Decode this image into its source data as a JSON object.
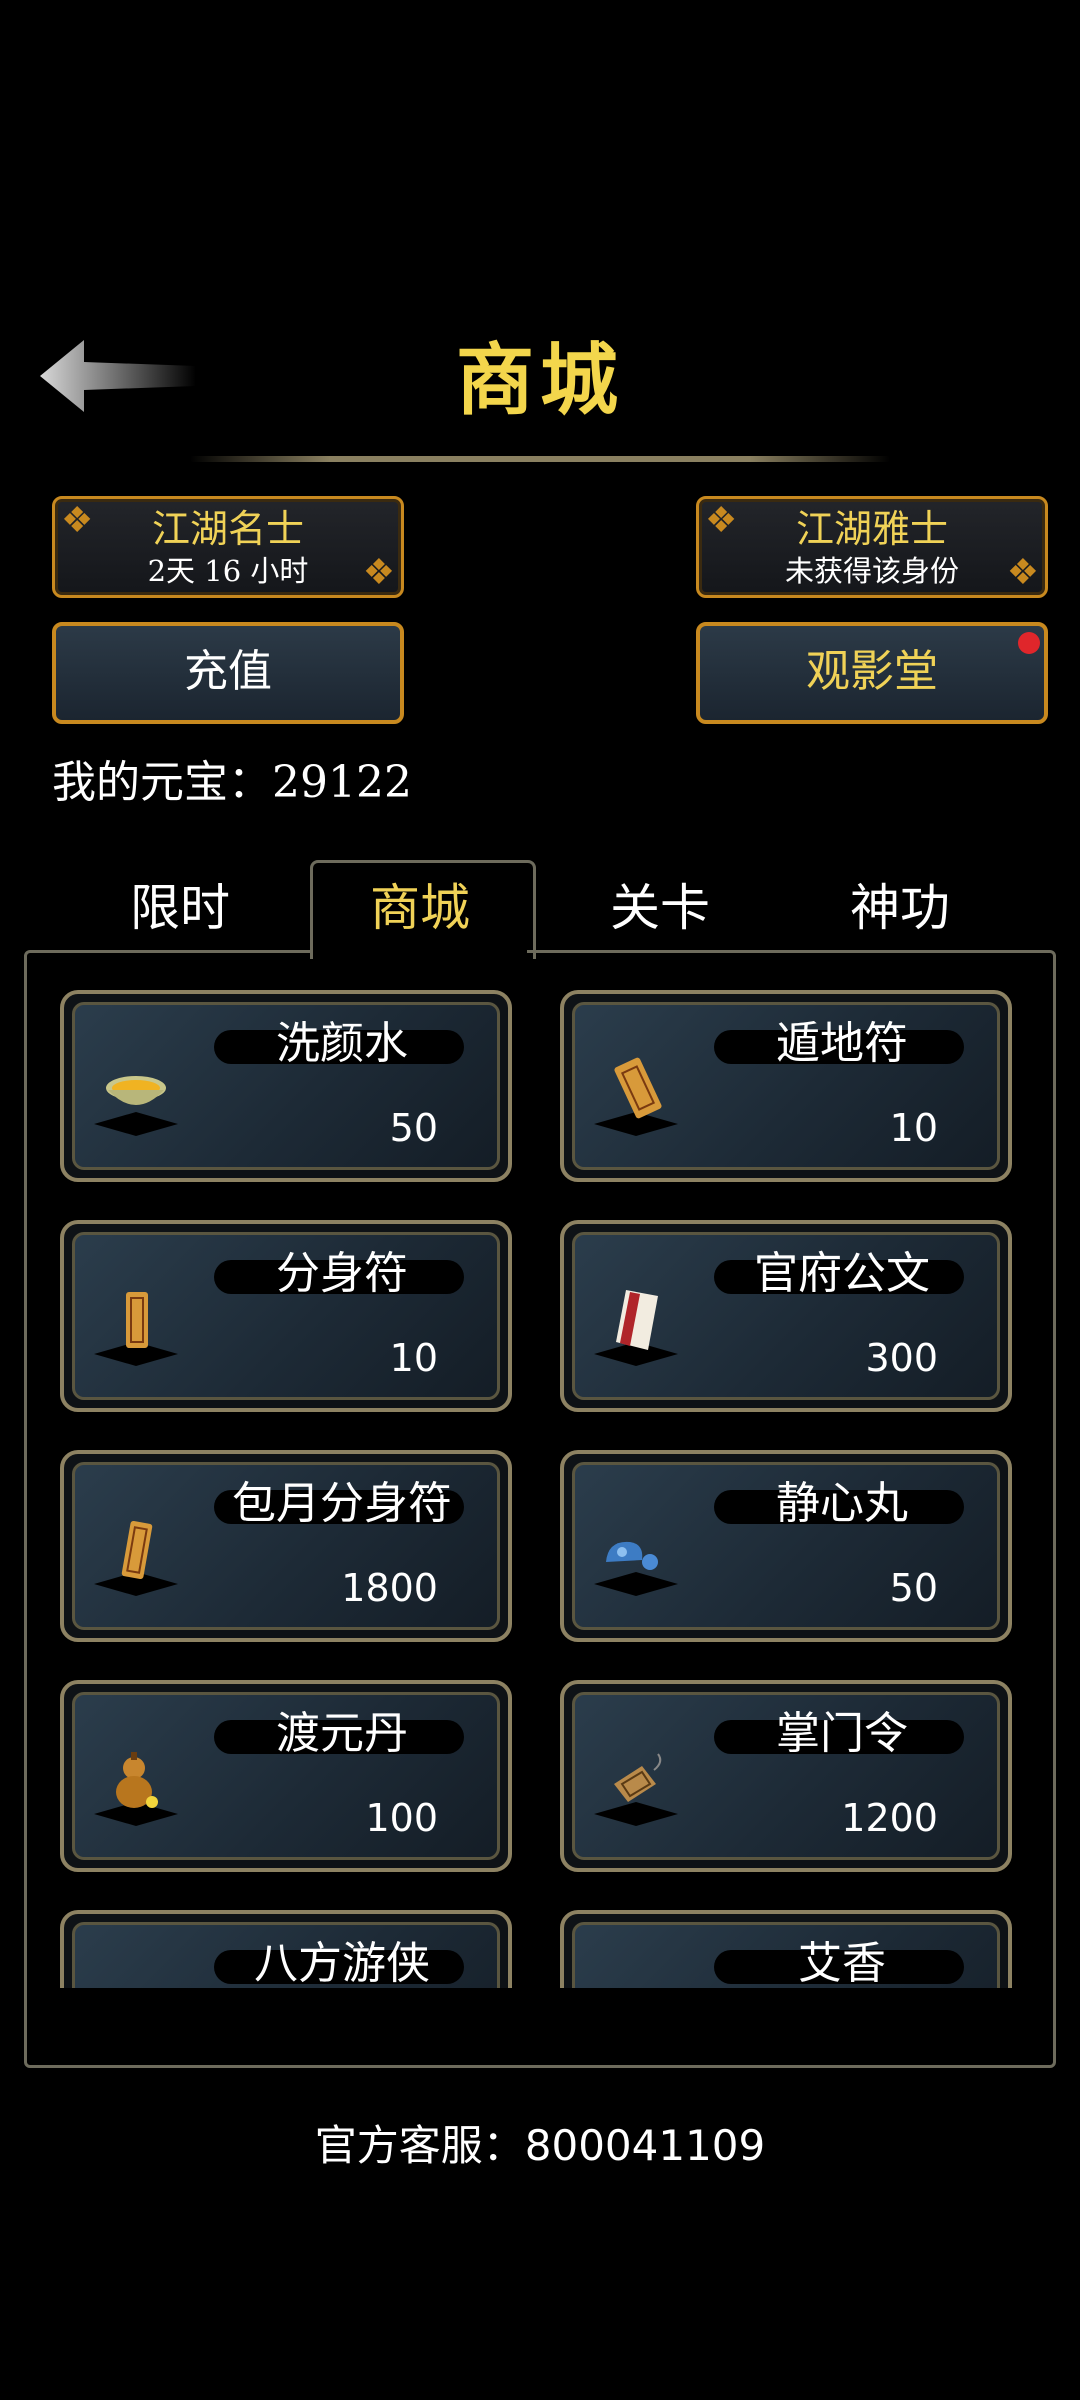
{
  "header": {
    "title": "商城"
  },
  "badges": {
    "left": {
      "name": "江湖名士",
      "sub": "2天 16 小时"
    },
    "right": {
      "name": "江湖雅士",
      "sub": "未获得该身份"
    }
  },
  "buttons": {
    "recharge": "充值",
    "cinema": "观影堂"
  },
  "ingots": "我的元宝：29122",
  "tabs": [
    {
      "label": "限时",
      "active": false
    },
    {
      "label": "商城",
      "active": true
    },
    {
      "label": "关卡",
      "active": false
    },
    {
      "label": "神功",
      "active": false
    }
  ],
  "items": [
    {
      "name": "洗颜水",
      "price": "50",
      "icon": "bowl-icon"
    },
    {
      "name": "遁地符",
      "price": "10",
      "icon": "talisman-icon"
    },
    {
      "name": "分身符",
      "price": "10",
      "icon": "talisman-icon"
    },
    {
      "name": "官府公文",
      "price": "300",
      "icon": "document-icon"
    },
    {
      "name": "包月分身符",
      "price": "1800",
      "icon": "talisman-icon"
    },
    {
      "name": "静心丸",
      "price": "50",
      "icon": "pill-icon"
    },
    {
      "name": "渡元丹",
      "price": "100",
      "icon": "gourd-icon"
    },
    {
      "name": "掌门令",
      "price": "1200",
      "icon": "token-icon"
    },
    {
      "name": "八方游侠",
      "price": "",
      "icon": "flower-icon"
    },
    {
      "name": "艾香",
      "price": "",
      "icon": "incense-icon"
    }
  ],
  "service": "官方客服：800041109",
  "colors": {
    "gold": "#f0d257",
    "border": "#c8891f",
    "alert": "#e0262b"
  }
}
